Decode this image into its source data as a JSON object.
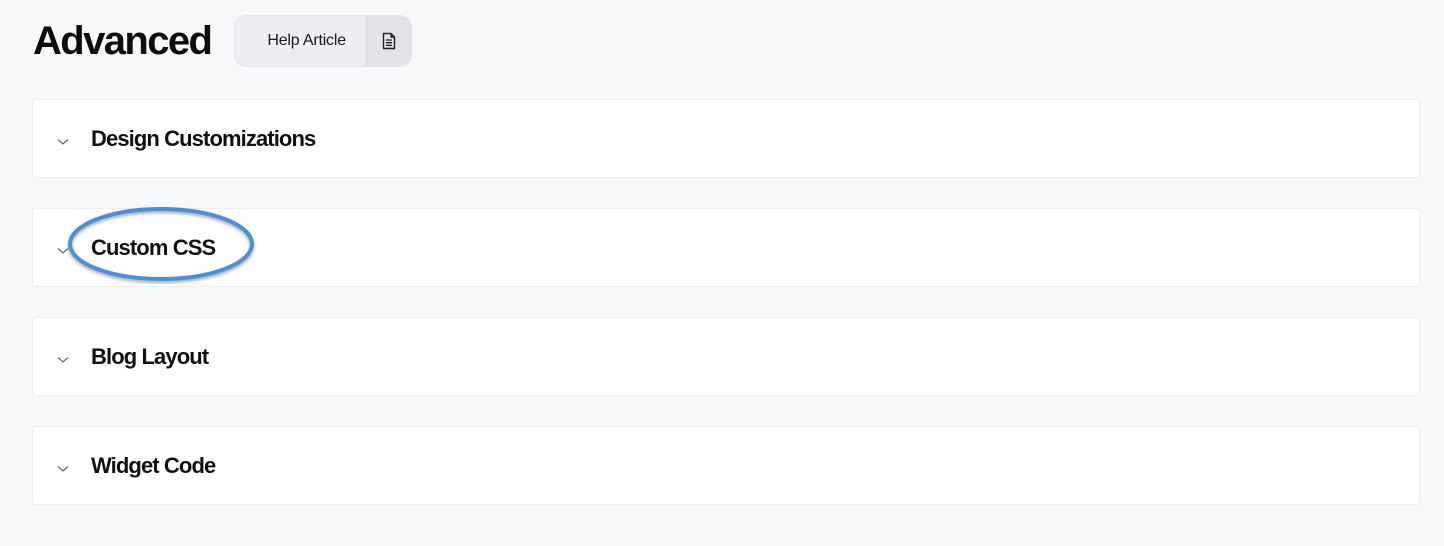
{
  "header": {
    "title": "Advanced",
    "help_button_label": "Help Article",
    "help_icon": "document-icon"
  },
  "sections": [
    {
      "title": "Design Customizations",
      "icon": "chevron-down-icon"
    },
    {
      "title": "Custom CSS",
      "icon": "chevron-down-icon",
      "highlighted": true
    },
    {
      "title": "Blog Layout",
      "icon": "chevron-down-icon"
    },
    {
      "title": "Widget Code",
      "icon": "chevron-down-icon"
    }
  ],
  "colors": {
    "background": "#f7f8fa",
    "card": "#ffffff",
    "highlight": "#4a90d9"
  }
}
